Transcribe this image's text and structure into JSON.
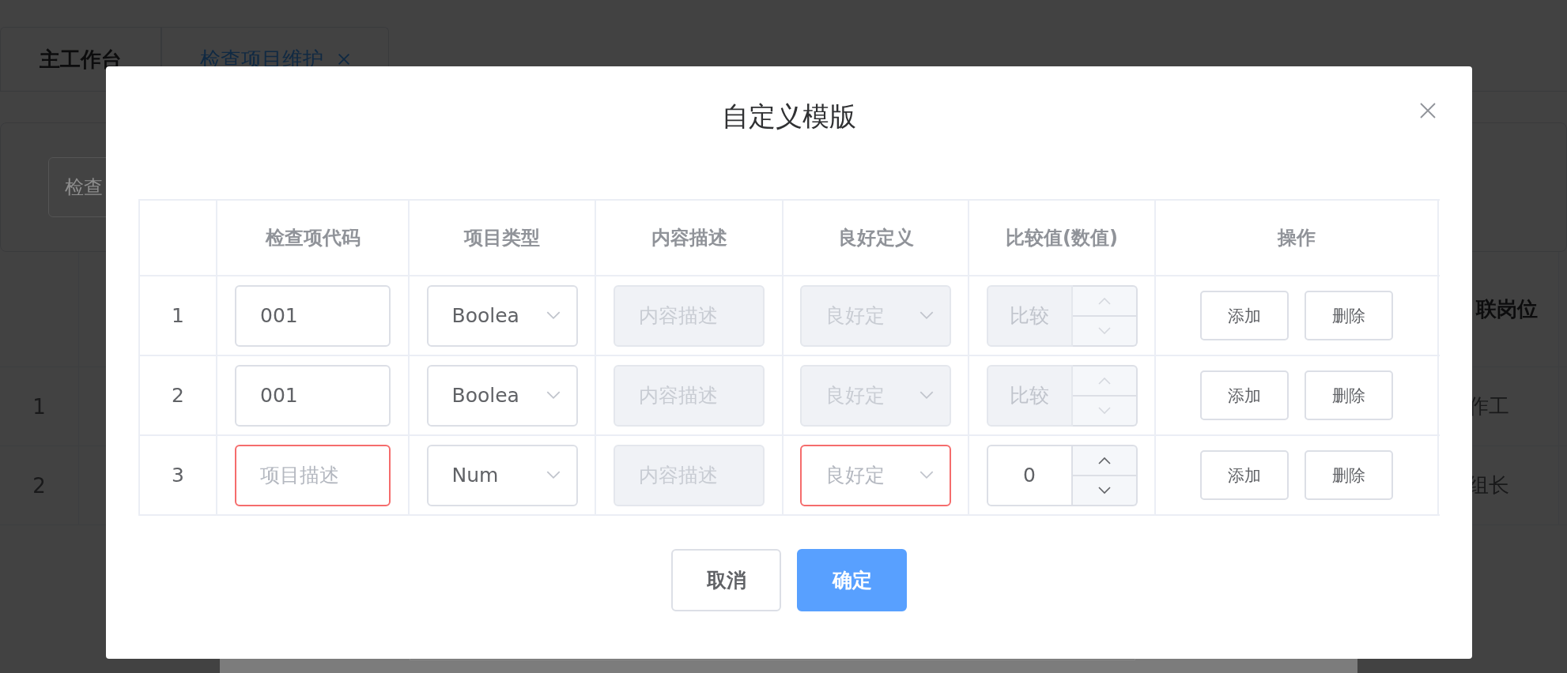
{
  "background": {
    "tabs": [
      {
        "label": "主工作台",
        "selected": false,
        "closable": false
      },
      {
        "label": "检查项目维护",
        "selected": true,
        "closable": true
      }
    ],
    "search": {
      "placeholder": "检查"
    },
    "table": {
      "header": "联岗位",
      "rows": [
        {
          "index": "1",
          "column_last": "作工"
        },
        {
          "index": "2",
          "column_last": "组长"
        }
      ]
    }
  },
  "dialog": {
    "title": "自定义模版",
    "columns": [
      "检查项代码",
      "项目类型",
      "内容描述",
      "良好定义",
      "比较值(数值)",
      "操作"
    ],
    "rows": [
      {
        "index": "1",
        "code": {
          "value": "001",
          "invalid": false
        },
        "type": {
          "value": "Boolea"
        },
        "description": {
          "placeholder": "内容描述",
          "disabled": true
        },
        "good_definition": {
          "placeholder": "良好定",
          "disabled": true,
          "invalid": false
        },
        "compare": {
          "placeholder": "比较",
          "disabled": true
        },
        "actions": [
          "添加",
          "删除"
        ]
      },
      {
        "index": "2",
        "code": {
          "value": "001",
          "invalid": false
        },
        "type": {
          "value": "Boolea"
        },
        "description": {
          "placeholder": "内容描述",
          "disabled": true
        },
        "good_definition": {
          "placeholder": "良好定",
          "disabled": true,
          "invalid": false
        },
        "compare": {
          "placeholder": "比较",
          "disabled": true
        },
        "actions": [
          "添加",
          "删除"
        ]
      },
      {
        "index": "3",
        "code": {
          "placeholder": "项目描述",
          "invalid": true
        },
        "type": {
          "value": "Num"
        },
        "description": {
          "placeholder": "内容描述",
          "disabled": true
        },
        "good_definition": {
          "placeholder": "良好定",
          "disabled": false,
          "invalid": true
        },
        "compare": {
          "value": "0",
          "disabled": false
        },
        "actions": [
          "添加",
          "删除"
        ]
      }
    ],
    "buttons": [
      {
        "label": "取消",
        "kind": "default"
      },
      {
        "label": "确定",
        "kind": "primary"
      }
    ]
  }
}
